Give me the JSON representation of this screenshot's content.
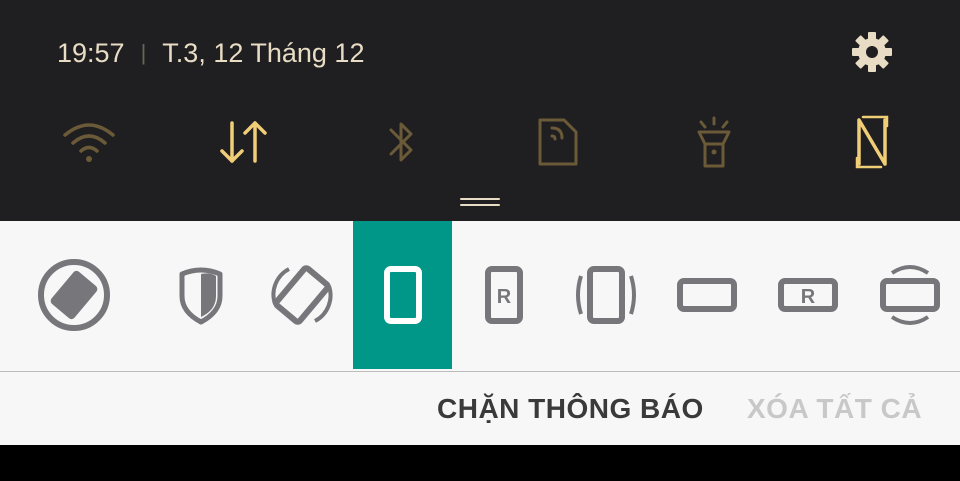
{
  "status_bar": {
    "time": "19:57",
    "separator": "|",
    "date": "T.3, 12 Tháng 12"
  },
  "quick_settings": [
    {
      "name": "wifi-icon",
      "active": false
    },
    {
      "name": "mobile-data-icon",
      "active": true
    },
    {
      "name": "bluetooth-icon",
      "active": false
    },
    {
      "name": "nfc-card-icon",
      "active": false
    },
    {
      "name": "flashlight-icon",
      "active": false
    },
    {
      "name": "nfc-icon",
      "active": true
    }
  ],
  "colors": {
    "panel_bg": "#1f1f21",
    "icon_active": "#f0cd77",
    "icon_inactive": "#6b5a37",
    "selected_bg": "#009688",
    "notif_icon": "#77777b"
  },
  "notification_icons": [
    "auto-rotate-icon",
    "shield-icon",
    "screen-rotation-icon",
    "phone-portrait-icon",
    "phone-portrait-r-icon",
    "phone-vibrate-icon",
    "phone-landscape-icon",
    "phone-landscape-r-icon",
    "landscape-rotate-icon"
  ],
  "actions": {
    "block_label": "CHẶN THÔNG BÁO",
    "clear_all_label": "XÓA TẤT CẢ"
  }
}
